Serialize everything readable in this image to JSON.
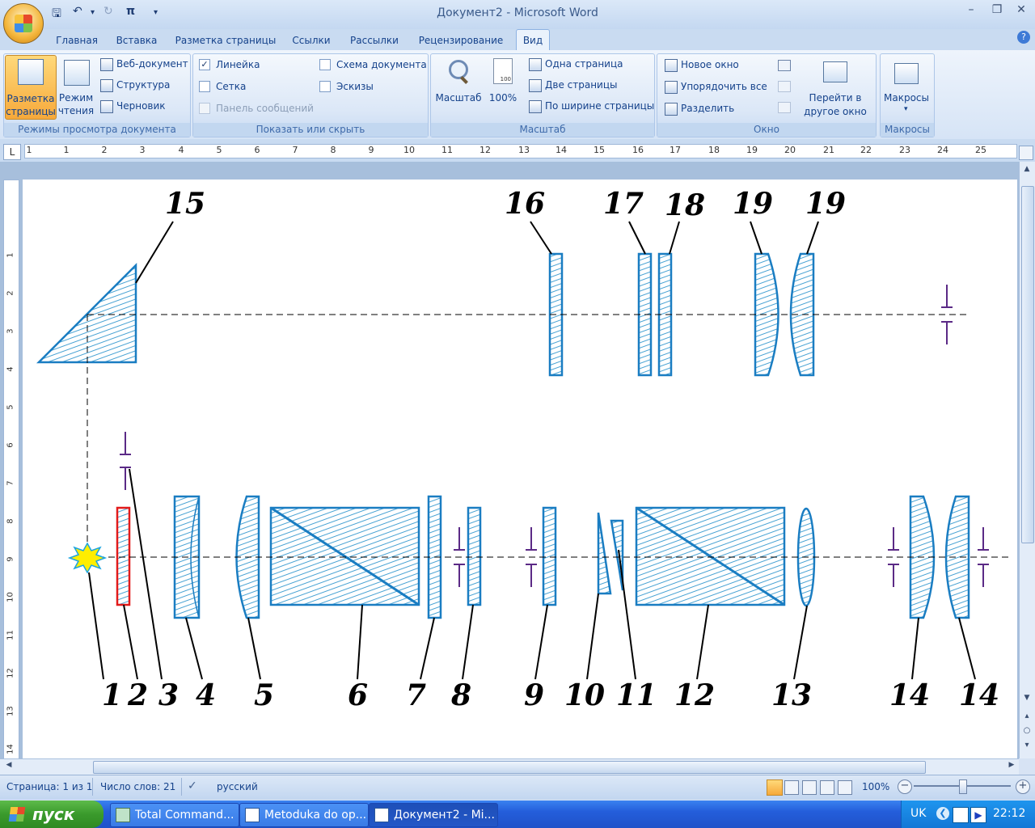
{
  "window": {
    "title": "Документ2 - Microsoft Word"
  },
  "quick_access": {
    "save_icon": "save-icon",
    "undo_icon": "undo-icon",
    "redo_icon": "redo-icon",
    "pi_symbol": "π"
  },
  "tabs": [
    "Главная",
    "Вставка",
    "Разметка страницы",
    "Ссылки",
    "Рассылки",
    "Рецензирование",
    "Вид"
  ],
  "active_tab": "Вид",
  "ribbon": {
    "views": {
      "label": "Режимы просмотра документа",
      "print_layout_line1": "Разметка",
      "print_layout_line2": "страницы",
      "reading_line1": "Режим",
      "reading_line2": "чтения",
      "web": "Веб-документ",
      "outline": "Структура",
      "draft": "Черновик"
    },
    "show": {
      "label": "Показать или скрыть",
      "ruler": "Линейка",
      "gridlines": "Сетка",
      "message_bar": "Панель сообщений",
      "doc_map": "Схема документа",
      "thumbnails": "Эскизы",
      "ruler_checked": true
    },
    "zoom": {
      "label": "Масштаб",
      "zoom": "Масштаб",
      "hundred": "100%",
      "one_page": "Одна страница",
      "two_pages": "Две страницы",
      "page_width": "По ширине страницы"
    },
    "window": {
      "label": "Окно",
      "new_window": "Новое окно",
      "arrange_all": "Упорядочить все",
      "split": "Разделить",
      "switch_line1": "Перейти в",
      "switch_line2": "другое окно"
    },
    "macros": {
      "label": "Макросы",
      "macros": "Макросы"
    }
  },
  "ruler": {
    "numbers": [
      "1",
      "1",
      "2",
      "3",
      "4",
      "5",
      "6",
      "7",
      "8",
      "9",
      "10",
      "11",
      "12",
      "13",
      "14",
      "15",
      "16",
      "17",
      "18",
      "19",
      "20",
      "21",
      "22",
      "23",
      "24",
      "25"
    ],
    "vnumbers": [
      "1",
      "2",
      "3",
      "4",
      "5",
      "6",
      "7",
      "8",
      "9",
      "10",
      "11",
      "12",
      "13",
      "14"
    ]
  },
  "diagram": {
    "bottom_labels": [
      "1",
      "2",
      "3",
      "4",
      "5",
      "6",
      "7",
      "8",
      "9",
      "10",
      "11",
      "12",
      "13",
      "14",
      "14"
    ],
    "top_labels": [
      "15",
      "16",
      "17",
      "18",
      "19",
      "19"
    ]
  },
  "status": {
    "page": "Страница: 1 из 1",
    "words": "Число слов: 21",
    "language": "русский",
    "zoom": "100%"
  },
  "taskbar": {
    "start": "пуск",
    "items": [
      "Total Command...",
      "Metoduka do op...",
      "Документ2 - Mi..."
    ],
    "lang": "UK",
    "time": "22:12"
  }
}
